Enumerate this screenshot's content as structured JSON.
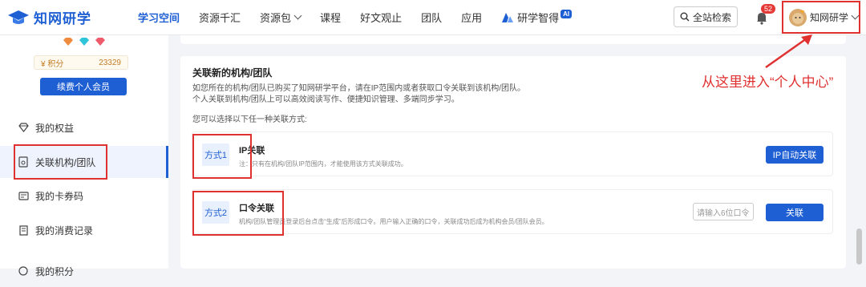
{
  "header": {
    "logo_text": "知网研学",
    "nav": [
      {
        "label": "学习空间",
        "active": true
      },
      {
        "label": "资源千汇"
      },
      {
        "label": "资源包",
        "dropdown": true
      },
      {
        "label": "课程"
      },
      {
        "label": "好文观止"
      },
      {
        "label": "团队"
      },
      {
        "label": "应用"
      }
    ],
    "ai_app": {
      "label": "研学智得",
      "badge": "AI"
    },
    "search_label": "全站检索",
    "notification_count": "52",
    "user_name": "知网研学"
  },
  "sidebar": {
    "points_label": "积分",
    "points_value": "23329",
    "renew_label": "续费个人会员",
    "items": [
      {
        "label": "我的权益",
        "icon": "diamond-icon"
      },
      {
        "label": "关联机构/团队",
        "icon": "link-doc-icon",
        "active": true
      },
      {
        "label": "我的卡券码",
        "icon": "card-icon"
      },
      {
        "label": "我的消费记录",
        "icon": "receipt-icon"
      },
      {
        "label": "我的积分",
        "icon": "points-icon"
      }
    ]
  },
  "main": {
    "title": "关联新的机构/团队",
    "desc1": "如您所在的机构/团队已购买了知网研学平台，请在IP范围内或者获取口令关联到该机构/团队。",
    "desc2": "个人关联到机构/团队上可以高效阅读写作、便捷知识管理、多端同步学习。",
    "choose_label": "您可以选择以下任一种关联方式:",
    "methods": [
      {
        "tag": "方式1",
        "title": "IP关联",
        "note": "注：只有在机构/团队IP范围内，才能使用该方式关联成功。",
        "button": "IP自动关联"
      },
      {
        "tag": "方式2",
        "title": "口令关联",
        "note": "机构/团队管理员登录后台点击“生成”后形成口令。用户输入正确的口令，关联成功后成为机构会员/团队会员。",
        "input_placeholder": "请输入6位口令",
        "button": "关联"
      }
    ]
  },
  "annotation": {
    "text": "从这里进入“个人中心”"
  },
  "colors": {
    "brand": "#1f5fd4",
    "annotation_red": "#e03131"
  }
}
